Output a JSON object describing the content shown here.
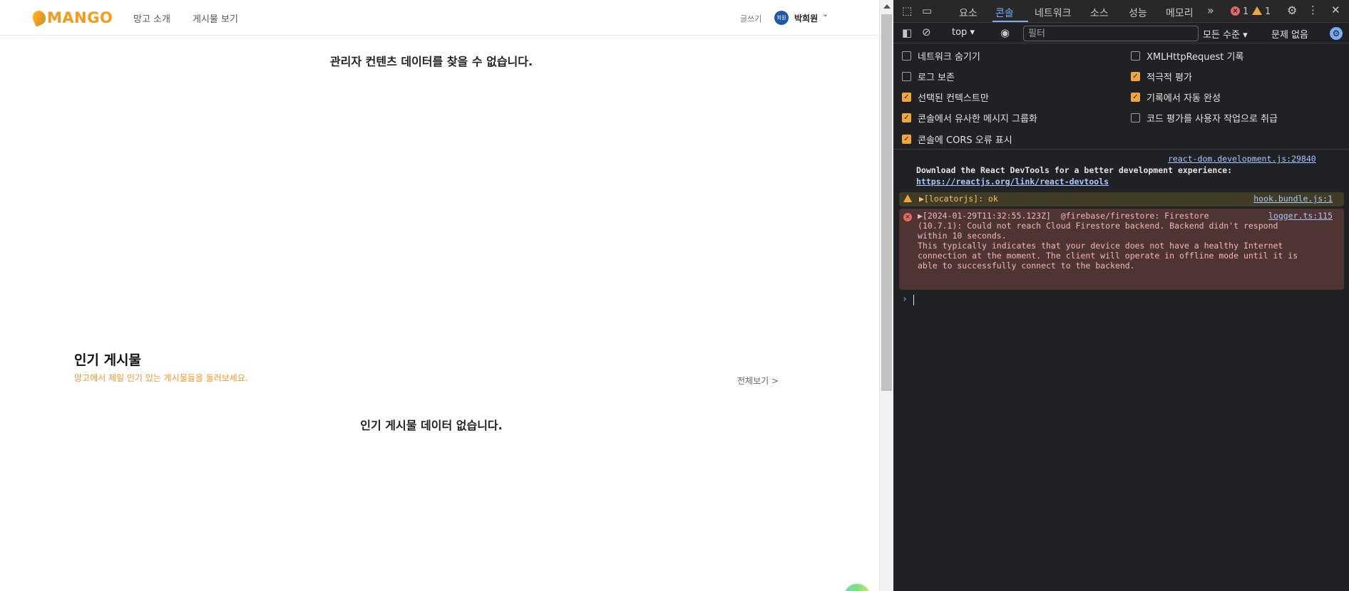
{
  "site": {
    "logo_text": "MANGO",
    "nav": {
      "about": "망고 소개",
      "board": "게시물 보기"
    },
    "write": "글쓰기",
    "avatar_badge": "회원",
    "user_name": "박희원",
    "no_admin_content": "관리자 컨텐츠 데이터를 찾을 수 없습니다.",
    "popular": {
      "title": "인기 게시물",
      "subtitle": "망고에서 제일 인기 있는 게시물들을 둘러보세요.",
      "see_all": "전체보기 >",
      "empty": "인기 게시물 데이터 없습니다."
    }
  },
  "devtools": {
    "tabs": [
      "요소",
      "콘솔",
      "네트워크",
      "소스",
      "성능",
      "메모리"
    ],
    "active_tab": "콘솔",
    "error_count": "1",
    "warning_count": "1",
    "context": "top",
    "filter_placeholder": "필터",
    "level": "모든 수준",
    "issues": "문제 없음",
    "settings": [
      {
        "label": "네트워크 숨기기",
        "checked": false
      },
      {
        "label": "XMLHttpRequest 기록",
        "checked": false
      },
      {
        "label": "로그 보존",
        "checked": false
      },
      {
        "label": "적극적 평가",
        "checked": true
      },
      {
        "label": "선택된 컨텍스트만",
        "checked": true
      },
      {
        "label": "기록에서 자동 완성",
        "checked": true
      },
      {
        "label": "콘솔에서 유사한 메시지 그룹화",
        "checked": true
      },
      {
        "label": "코드 평가를 사용자 작업으로 취급",
        "checked": false
      },
      {
        "label": "콘솔에 CORS 오류 표시",
        "checked": true
      }
    ],
    "messages": {
      "react": {
        "source": "react-dom.development.js:29840",
        "text": "Download the React DevTools for a better development experience: ",
        "link": "https://reactjs.org/link/react-devtools"
      },
      "warning": {
        "text": "▶[locatorjs]: ok",
        "source": "hook.bundle.js:1"
      },
      "error": {
        "text": "▶[2024-01-29T11:32:55.123Z]  @firebase/firestore: Firestore\n(10.7.1): Could not reach Cloud Firestore backend. Backend didn't respond\nwithin 10 seconds.\nThis typically indicates that your device does not have a healthy Internet\nconnection at the moment. The client will operate in offline mode until it is\nable to successfully connect to the backend.",
        "source": "logger.ts:115"
      }
    }
  }
}
